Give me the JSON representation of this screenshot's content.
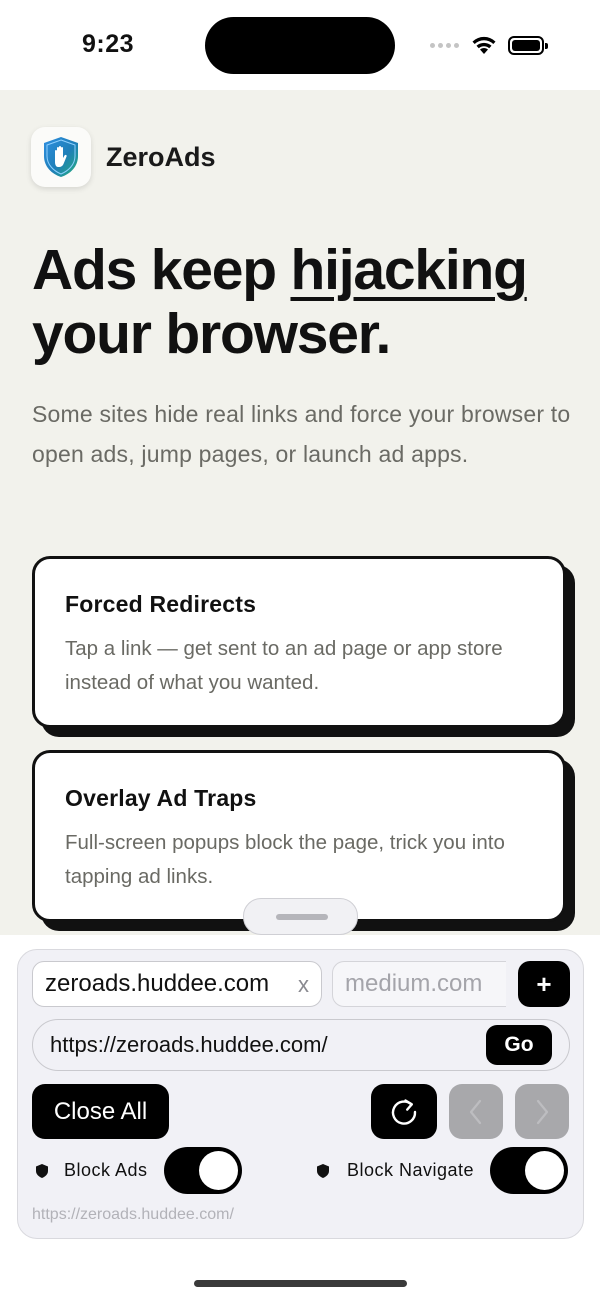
{
  "status_bar": {
    "time": "9:23",
    "icons": [
      "cellular-signal-icon",
      "wifi-icon",
      "battery-icon"
    ]
  },
  "app": {
    "name": "ZeroAds",
    "logo_icon": "shield-hand-icon"
  },
  "hero": {
    "title_pre": "Ads keep ",
    "title_emphasis": "hijacking",
    "title_post": "your browser.",
    "subtitle": "Some sites hide real links and force your browser to open ads, jump pages, or launch ad apps."
  },
  "cards": [
    {
      "title": "Forced Redirects",
      "body": "Tap a link — get sent to an ad page or app store instead of what you wanted."
    },
    {
      "title": "Overlay Ad Traps",
      "body": "Full-screen popups block the page, trick you into tapping ad links."
    }
  ],
  "browser_panel": {
    "tabs": [
      {
        "label": "zeroads.huddee.com",
        "close_label": "x",
        "active": true
      },
      {
        "label": "medium.com",
        "active": false
      }
    ],
    "add_tab_label": "+",
    "url_input_value": "https://zeroads.huddee.com/",
    "go_label": "Go",
    "close_all_label": "Close All",
    "reload_icon": "reload-icon",
    "back_icon": "chevron-left-icon",
    "forward_icon": "chevron-right-icon",
    "toggles": [
      {
        "label": "Block Ads",
        "icon": "shield-icon",
        "on": true
      },
      {
        "label": "Block Navigate",
        "icon": "shield-icon",
        "on": true
      }
    ],
    "current_url": "https://zeroads.huddee.com/"
  },
  "colors": {
    "page_background": "#f2f2ec",
    "accent": "#000000",
    "muted_text": "#6a6a64",
    "disabled_button": "#a8a8ab",
    "panel_background": "#f1f1f6"
  }
}
